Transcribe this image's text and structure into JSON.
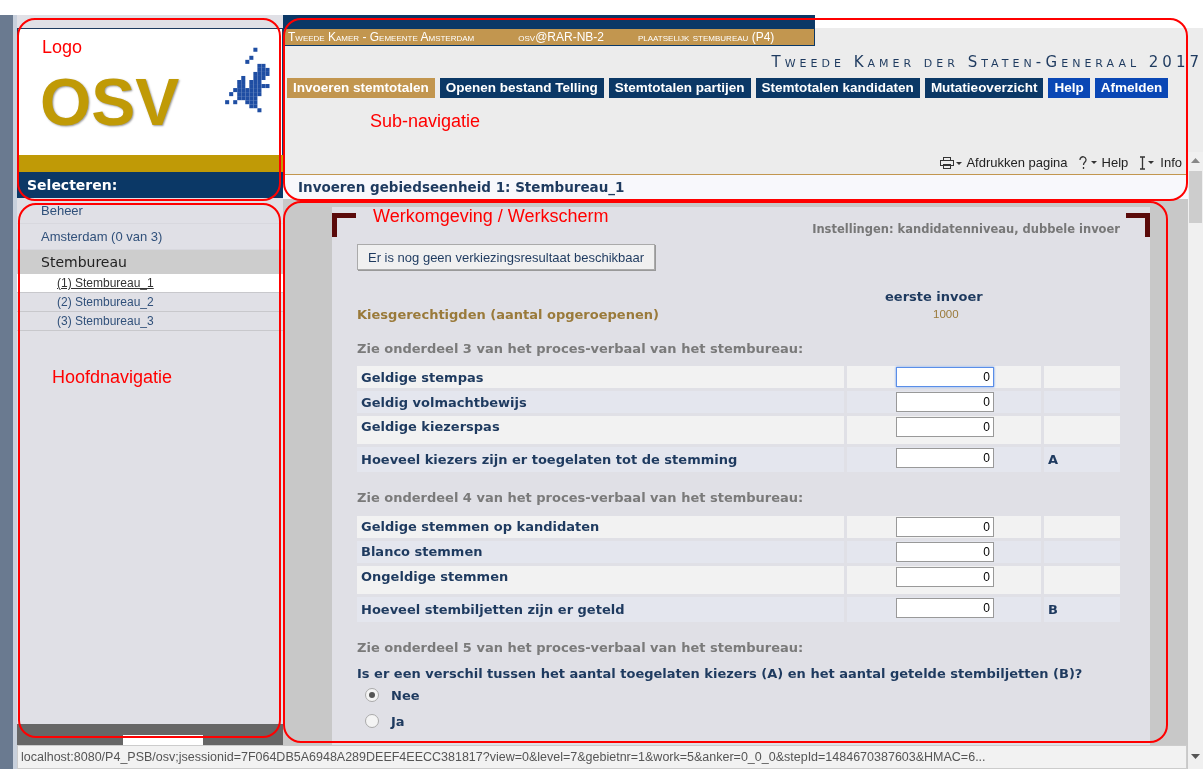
{
  "header": {
    "info": [
      "Tweede Kamer - Gemeente Amsterdam",
      "osv@RAR-NB-2",
      "plaatselijk stembureau (P4)"
    ],
    "title": "Tweede Kamer der Staten-Generaal 2017"
  },
  "logo": {
    "text": "OSV"
  },
  "tabs": [
    {
      "label": "Invoeren stemtotalen",
      "kind": "page",
      "selected": true
    },
    {
      "label": "Openen bestand Telling",
      "kind": "page",
      "selected": false
    },
    {
      "label": "Stemtotalen partijen",
      "kind": "page",
      "selected": false
    },
    {
      "label": "Stemtotalen kandidaten",
      "kind": "page",
      "selected": false
    },
    {
      "label": "Mutatieoverzicht",
      "kind": "page",
      "selected": false
    },
    {
      "label": "Help",
      "kind": "action",
      "selected": false
    },
    {
      "label": "Afmelden",
      "kind": "action",
      "selected": false
    }
  ],
  "tools": [
    {
      "kind": "print",
      "label": "Afdrukken pagina"
    },
    {
      "kind": "help",
      "label": "Help"
    },
    {
      "kind": "info",
      "label": "Info"
    }
  ],
  "breadcrumb": "Invoeren gebiedseenheid 1: Stembureau_1",
  "sidebar": {
    "heading": "Selecteren:",
    "items": [
      {
        "kind": "link",
        "label": "Beheer"
      },
      {
        "kind": "link",
        "label": "Amsterdam (0 van 3)"
      },
      {
        "kind": "group",
        "label": "Stembureau",
        "children": [
          {
            "label": "(1) Stembureau_1",
            "selected": true
          },
          {
            "label": "(2) Stembureau_2",
            "selected": false
          },
          {
            "label": "(3) Stembureau_3",
            "selected": false
          }
        ]
      }
    ]
  },
  "form": {
    "settings": "Instellingen: kandidatenniveau, dubbele invoer",
    "button": "Er is nog geen verkiezingsresultaat beschikbaar",
    "column": "eerste invoer",
    "eligible": {
      "label": "Kiesgerechtigden (aantal opgeroepenen)",
      "value": "1000"
    },
    "sections": [
      {
        "heading": "Zie onderdeel 3 van het proces-verbaal van het stembureau:",
        "rows": [
          {
            "label": "Geldige stempas",
            "value": "0",
            "focused": true
          },
          {
            "label": "Geldig volmachtbewijs",
            "value": "0",
            "focused": false
          },
          {
            "label": "Geldige kiezerspas",
            "value": "0",
            "focused": false
          },
          {
            "label": "Hoeveel kiezers zijn er toegelaten tot de stemming",
            "value": "0",
            "focused": false,
            "mark": "A"
          }
        ]
      },
      {
        "heading": "Zie onderdeel 4 van het proces-verbaal van het stembureau:",
        "rows": [
          {
            "label": "Geldige stemmen op kandidaten",
            "value": "0",
            "focused": false
          },
          {
            "label": "Blanco stemmen",
            "value": "0",
            "focused": false
          },
          {
            "label": "Ongeldige stemmen",
            "value": "0",
            "focused": false
          },
          {
            "label": "Hoeveel stembiljetten zijn er geteld",
            "value": "0",
            "focused": false,
            "mark": "B"
          }
        ]
      },
      {
        "heading": "Zie onderdeel 5 van het proces-verbaal van het stembureau:",
        "question": "Is er een verschil tussen het aantal toegelaten kiezers (A) en het aantal getelde stembiljetten (B)?",
        "options": [
          {
            "label": "Nee",
            "selected": true
          },
          {
            "label": "Ja",
            "selected": false
          }
        ]
      }
    ]
  },
  "status_bar": "localhost:8080/P4_PSB/osv;jsessionid=7F064DB5A6948A289DEEF4EECC381817?view=0&level=7&gebietnr=1&work=5&anker=0_0_0&stepId=1484670387603&HMAC=6...",
  "annotations": [
    {
      "label": "Logo"
    },
    {
      "label": "Sub-navigatie"
    },
    {
      "label": "Hoofdnavigatie"
    },
    {
      "label": "Werkomgeving / Werkscherm"
    }
  ]
}
